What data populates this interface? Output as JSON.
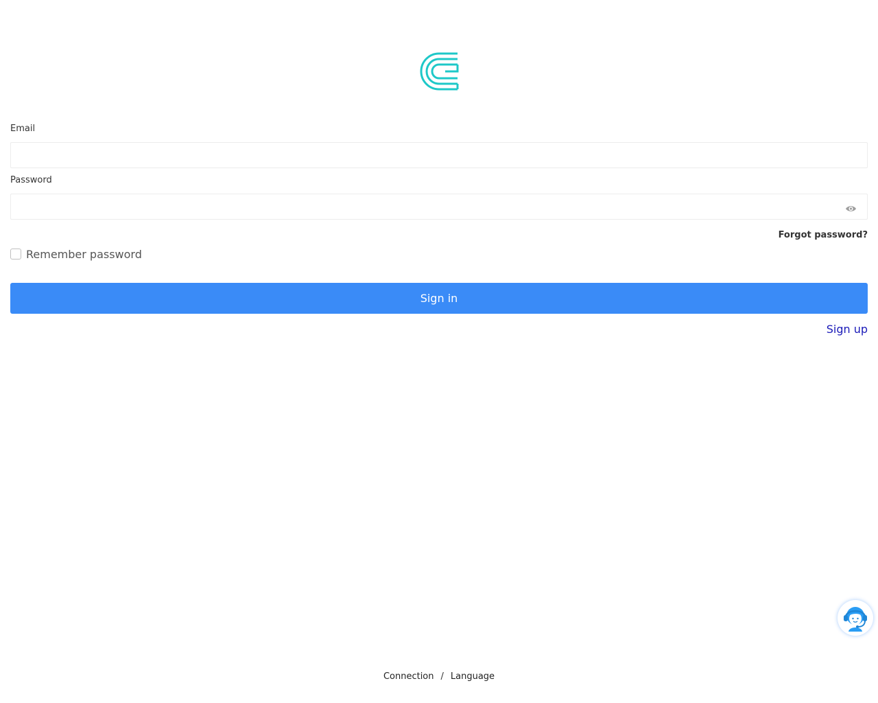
{
  "brand": {
    "logo": "brand-logo",
    "accent_color": "#1ec8c8"
  },
  "form": {
    "email": {
      "label": "Email",
      "value": "",
      "placeholder": ""
    },
    "password": {
      "label": "Password",
      "value": "",
      "placeholder": "",
      "toggle_icon": "eye-icon"
    },
    "forgot_password": "Forgot password?",
    "remember_password": {
      "label": "Remember password",
      "checked": false
    },
    "sign_in_label": "Sign in",
    "sign_in_color": "#3a8bf7",
    "sign_up_label": "Sign up",
    "sign_up_color": "#1a1ab8"
  },
  "support": {
    "icon": "customer-support-icon",
    "color": "#2a9df4"
  },
  "footer": {
    "connection": "Connection",
    "separator": "/",
    "language": "Language"
  }
}
